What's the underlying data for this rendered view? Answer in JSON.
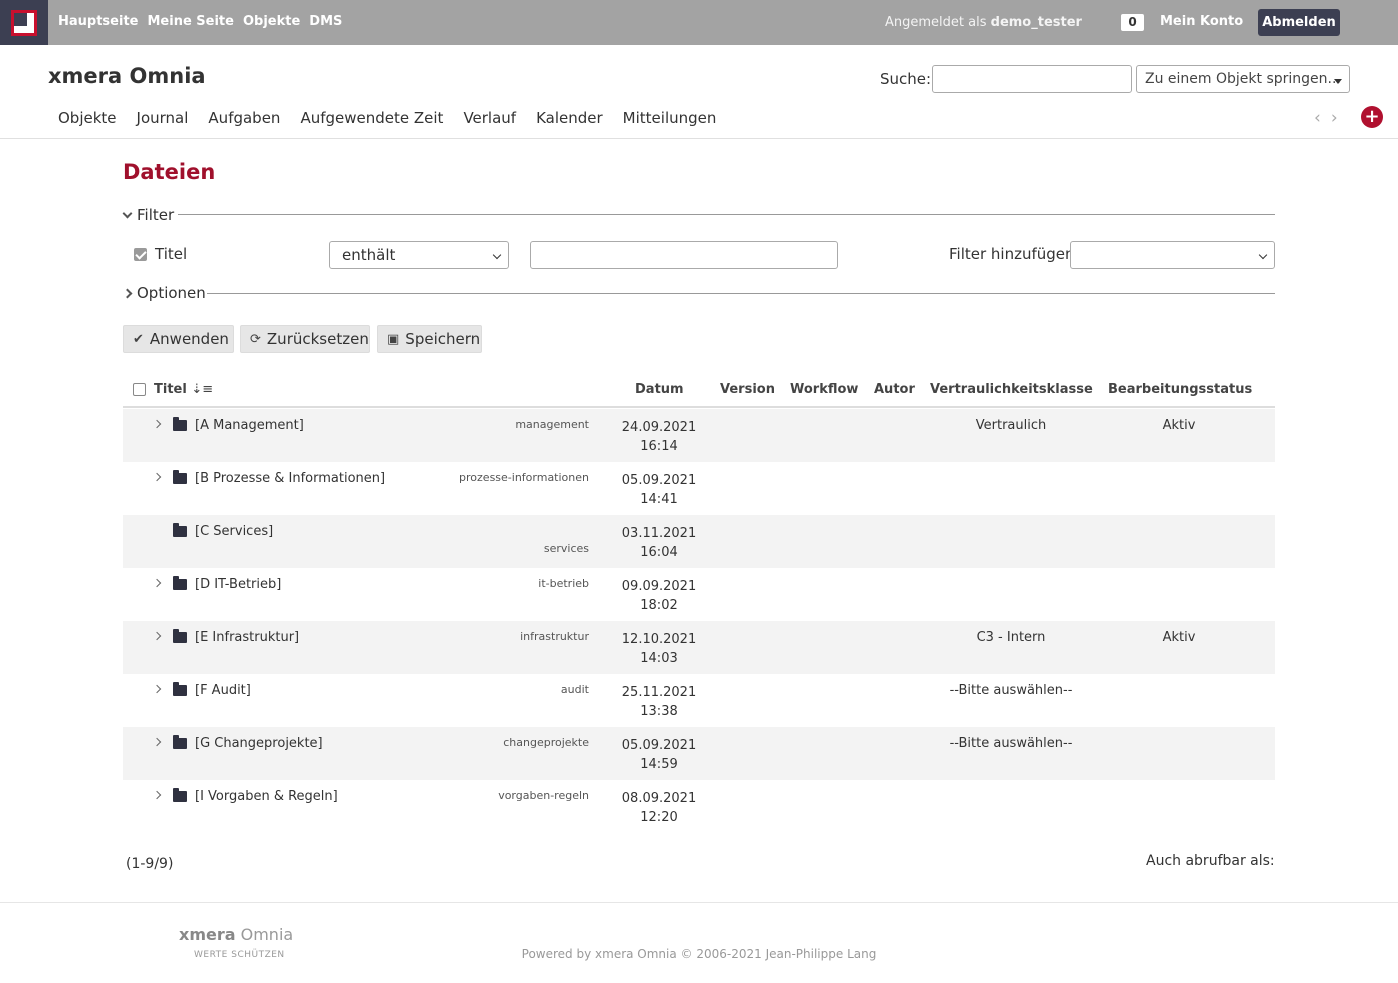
{
  "topbar": {
    "nav": [
      "Hauptseite",
      "Meine Seite",
      "Objekte",
      "DMS"
    ],
    "logged_in_prefix": "Angemeldet als",
    "username": "demo_tester",
    "counter": "0",
    "my_account": "Mein Konto",
    "logout": "Abmelden"
  },
  "header": {
    "app_title": "xmera Omnia",
    "search_label": "Suche:",
    "search_placeholder": "",
    "jump_label": "Zu einem Objekt springen...",
    "menu": [
      "Objekte",
      "Journal",
      "Aufgaben",
      "Aufgewendete Zeit",
      "Verlauf",
      "Kalender",
      "Mitteilungen"
    ],
    "plus": "+"
  },
  "page": {
    "title": "Dateien",
    "filter_legend": "Filter",
    "filter_field_label": "Titel",
    "filter_operator": "enthält",
    "filter_value": "",
    "add_filter_label": "Filter hinzufügen",
    "add_filter_value": "",
    "options_legend": "Optionen",
    "buttons": {
      "apply": "Anwenden",
      "reset": "Zurücksetzen",
      "save": "Speichern"
    }
  },
  "table": {
    "columns": {
      "title": "Titel",
      "date": "Datum",
      "version": "Version",
      "workflow": "Workflow",
      "author": "Autor",
      "confidentiality": "Vertraulichkeitsklasse",
      "status": "Bearbeitungsstatus"
    },
    "rows": [
      {
        "title": "[A Management]",
        "slug": "management",
        "date": "24.09.2021",
        "time": "16:14",
        "confidentiality": "Vertraulich",
        "status": "Aktiv",
        "expandable": true
      },
      {
        "title": "[B Prozesse & Informationen]",
        "slug": "prozesse-informationen",
        "date": "05.09.2021",
        "time": "14:41",
        "confidentiality": "",
        "status": "",
        "expandable": true
      },
      {
        "title": "[C Services]",
        "slug": "services",
        "date": "03.11.2021",
        "time": "16:04",
        "confidentiality": "",
        "status": "",
        "expandable": false
      },
      {
        "title": "[D IT-Betrieb]",
        "slug": "it-betrieb",
        "date": "09.09.2021",
        "time": "18:02",
        "confidentiality": "",
        "status": "",
        "expandable": true
      },
      {
        "title": "[E Infrastruktur]",
        "slug": "infrastruktur",
        "date": "12.10.2021",
        "time": "14:03",
        "confidentiality": "C3 - Intern",
        "status": "Aktiv",
        "expandable": true
      },
      {
        "title": "[F Audit]",
        "slug": "audit",
        "date": "25.11.2021",
        "time": "13:38",
        "confidentiality": "--Bitte auswählen--",
        "status": "",
        "expandable": true
      },
      {
        "title": "[G Changeprojekte]",
        "slug": "changeprojekte",
        "date": "05.09.2021",
        "time": "14:59",
        "confidentiality": "--Bitte auswählen--",
        "status": "",
        "expandable": true
      },
      {
        "title": "[I Vorgaben & Regeln]",
        "slug": "vorgaben-regeln",
        "date": "08.09.2021",
        "time": "12:20",
        "confidentiality": "",
        "status": "",
        "expandable": true
      }
    ],
    "pagination": "(1-9/9)",
    "also_available": "Auch abrufbar als:"
  },
  "footer": {
    "logo_bold": "xmera",
    "logo_light": "Omnia",
    "slogan": "WERTE SCHÜTZEN",
    "powered": "Powered by xmera Omnia © 2006-2021 Jean-Philippe Lang"
  },
  "colors": {
    "accent": "#a0102c",
    "topbar": "#a3a3a3",
    "dark": "#3c3f52"
  }
}
